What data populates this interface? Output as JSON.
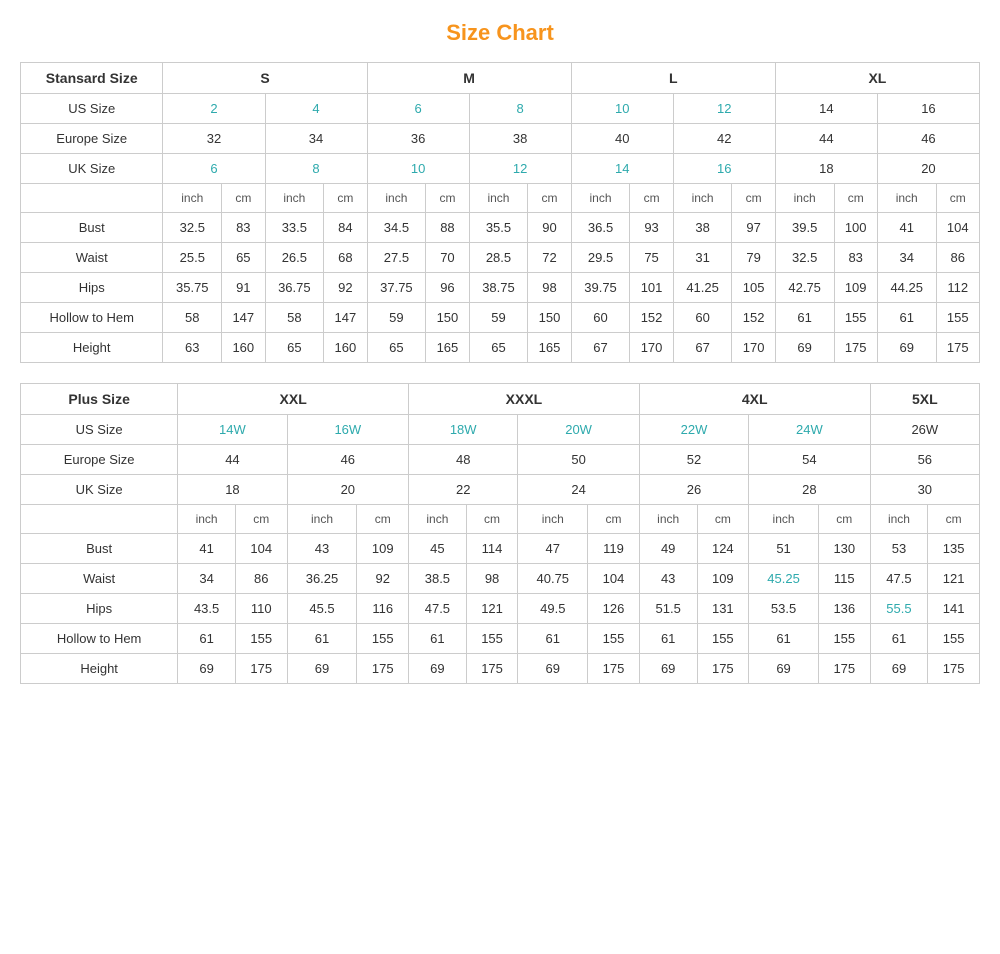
{
  "title": "Size Chart",
  "standard": {
    "headers": {
      "col1": "Stansard Size",
      "s": "S",
      "m": "M",
      "l": "L",
      "xl": "XL"
    },
    "us_size": {
      "label": "US Size",
      "values": [
        "2",
        "4",
        "6",
        "8",
        "10",
        "12",
        "14",
        "16"
      ]
    },
    "europe_size": {
      "label": "Europe Size",
      "values": [
        "32",
        "34",
        "36",
        "38",
        "40",
        "42",
        "44",
        "46"
      ]
    },
    "uk_size": {
      "label": "UK Size",
      "values": [
        "6",
        "8",
        "10",
        "12",
        "14",
        "16",
        "18",
        "20"
      ]
    },
    "units": [
      "inch",
      "cm",
      "inch",
      "cm",
      "inch",
      "cm",
      "inch",
      "cm",
      "inch",
      "cm",
      "inch",
      "cm",
      "inch",
      "cm",
      "inch",
      "cm"
    ],
    "bust": {
      "label": "Bust",
      "values": [
        "32.5",
        "83",
        "33.5",
        "84",
        "34.5",
        "88",
        "35.5",
        "90",
        "36.5",
        "93",
        "38",
        "97",
        "39.5",
        "100",
        "41",
        "104"
      ]
    },
    "waist": {
      "label": "Waist",
      "values": [
        "25.5",
        "65",
        "26.5",
        "68",
        "27.5",
        "70",
        "28.5",
        "72",
        "29.5",
        "75",
        "31",
        "79",
        "32.5",
        "83",
        "34",
        "86"
      ]
    },
    "hips": {
      "label": "Hips",
      "values": [
        "35.75",
        "91",
        "36.75",
        "92",
        "37.75",
        "96",
        "38.75",
        "98",
        "39.75",
        "101",
        "41.25",
        "105",
        "42.75",
        "109",
        "44.25",
        "112"
      ]
    },
    "hollow": {
      "label": "Hollow to Hem",
      "values": [
        "58",
        "147",
        "58",
        "147",
        "59",
        "150",
        "59",
        "150",
        "60",
        "152",
        "60",
        "152",
        "61",
        "155",
        "61",
        "155"
      ]
    },
    "height": {
      "label": "Height",
      "values": [
        "63",
        "160",
        "65",
        "160",
        "65",
        "165",
        "65",
        "165",
        "67",
        "170",
        "67",
        "170",
        "69",
        "175",
        "69",
        "175"
      ]
    }
  },
  "plus": {
    "headers": {
      "col1": "Plus Size",
      "xxl": "XXL",
      "xxxl": "XXXL",
      "4xl": "4XL",
      "5xl": "5XL"
    },
    "us_size": {
      "label": "US Size",
      "values": [
        "14W",
        "16W",
        "18W",
        "20W",
        "22W",
        "24W",
        "26W"
      ]
    },
    "europe_size": {
      "label": "Europe Size",
      "values": [
        "44",
        "46",
        "48",
        "50",
        "52",
        "54",
        "56"
      ]
    },
    "uk_size": {
      "label": "UK Size",
      "values": [
        "18",
        "20",
        "22",
        "24",
        "26",
        "28",
        "30"
      ]
    },
    "units": [
      "inch",
      "cm",
      "inch",
      "cm",
      "inch",
      "cm",
      "inch",
      "cm",
      "inch",
      "cm",
      "inch",
      "cm",
      "inch",
      "cm"
    ],
    "bust": {
      "label": "Bust",
      "values": [
        "41",
        "104",
        "43",
        "109",
        "45",
        "114",
        "47",
        "119",
        "49",
        "124",
        "51",
        "130",
        "53",
        "135"
      ]
    },
    "waist": {
      "label": "Waist",
      "values": [
        "34",
        "86",
        "36.25",
        "92",
        "38.5",
        "98",
        "40.75",
        "104",
        "43",
        "109",
        "45.25",
        "115",
        "47.5",
        "121"
      ]
    },
    "hips": {
      "label": "Hips",
      "values": [
        "43.5",
        "110",
        "45.5",
        "116",
        "47.5",
        "121",
        "49.5",
        "126",
        "51.5",
        "131",
        "53.5",
        "136",
        "55.5",
        "141"
      ]
    },
    "hollow": {
      "label": "Hollow to Hem",
      "values": [
        "61",
        "155",
        "61",
        "155",
        "61",
        "155",
        "61",
        "155",
        "61",
        "155",
        "61",
        "155",
        "61",
        "155"
      ]
    },
    "height": {
      "label": "Height",
      "values": [
        "69",
        "175",
        "69",
        "175",
        "69",
        "175",
        "69",
        "175",
        "69",
        "175",
        "69",
        "175",
        "69",
        "175"
      ]
    }
  }
}
